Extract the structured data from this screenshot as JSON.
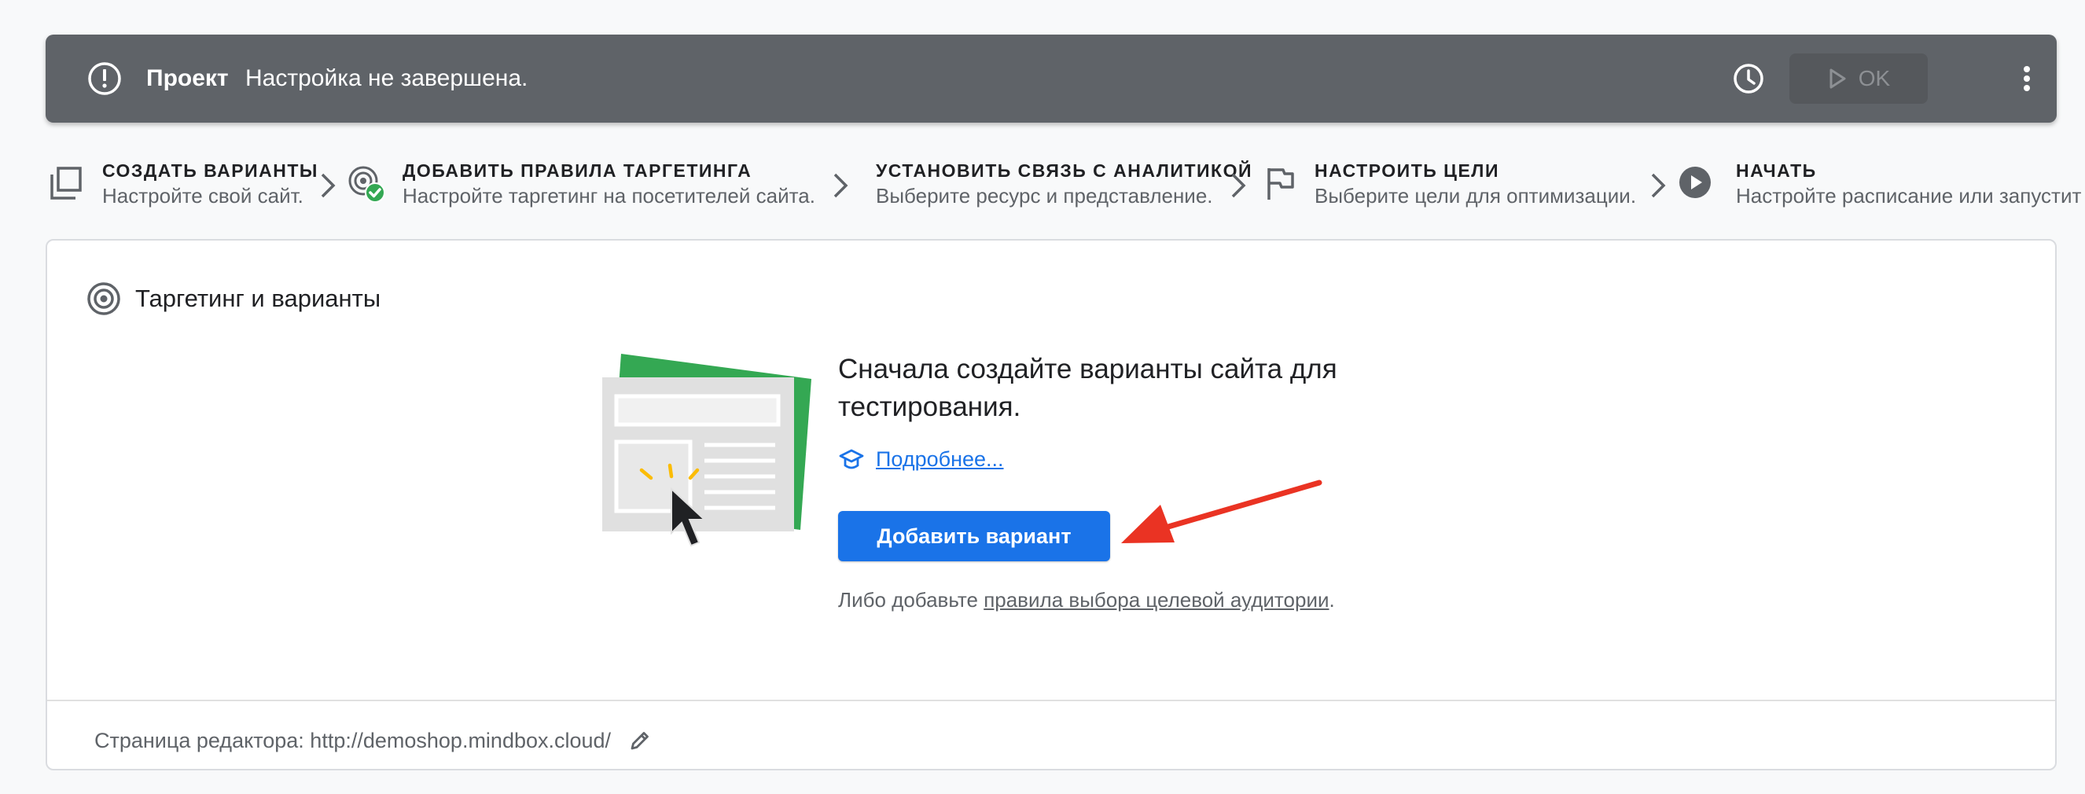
{
  "header": {
    "title": "Проект",
    "status": "Настройка не завершена.",
    "ok_label": "OK",
    "icons": {
      "alert": "alert-circle-icon",
      "history": "clock-icon",
      "play": "play-icon",
      "more": "more-vert-icon"
    }
  },
  "steps": [
    {
      "title": "СОЗДАТЬ ВАРИАНТЫ",
      "description": "Настройте свой сайт.",
      "icon": "copy-icon"
    },
    {
      "title": "ДОБАВИТЬ ПРАВИЛА ТАРГЕТИНГА",
      "description": "Настройте таргетинг на посетителей сайта.",
      "icon": "target-check-icon"
    },
    {
      "title": "УСТАНОВИТЬ СВЯЗЬ С АНАЛИТИКОЙ",
      "description": "Выберите ресурс и представление.",
      "icon": ""
    },
    {
      "title": "НАСТРОИТЬ ЦЕЛИ",
      "description": "Выберите цели для оптимизации.",
      "icon": "flag-icon"
    },
    {
      "title": "НАЧАТЬ",
      "description": "Настройте расписание или запустит",
      "icon": "play-circle-icon"
    }
  ],
  "card": {
    "title": "Таргетинг и варианты",
    "headline": "Сначала создайте варианты сайта для тестирования.",
    "learn_more": "Подробнее...",
    "add_variant_button": "Добавить вариант",
    "alt_prefix": "Либо добавьте ",
    "alt_link": "правила выбора целевой аудитории",
    "alt_suffix": ".",
    "footer_text": "Страница редактора: http://demoshop.mindbox.cloud/"
  },
  "colors": {
    "header_bg": "#5f6368",
    "primary": "#1a73e8",
    "success": "#34a853",
    "annotation": "#ea3323",
    "page_bg": "#f8f9fa"
  }
}
